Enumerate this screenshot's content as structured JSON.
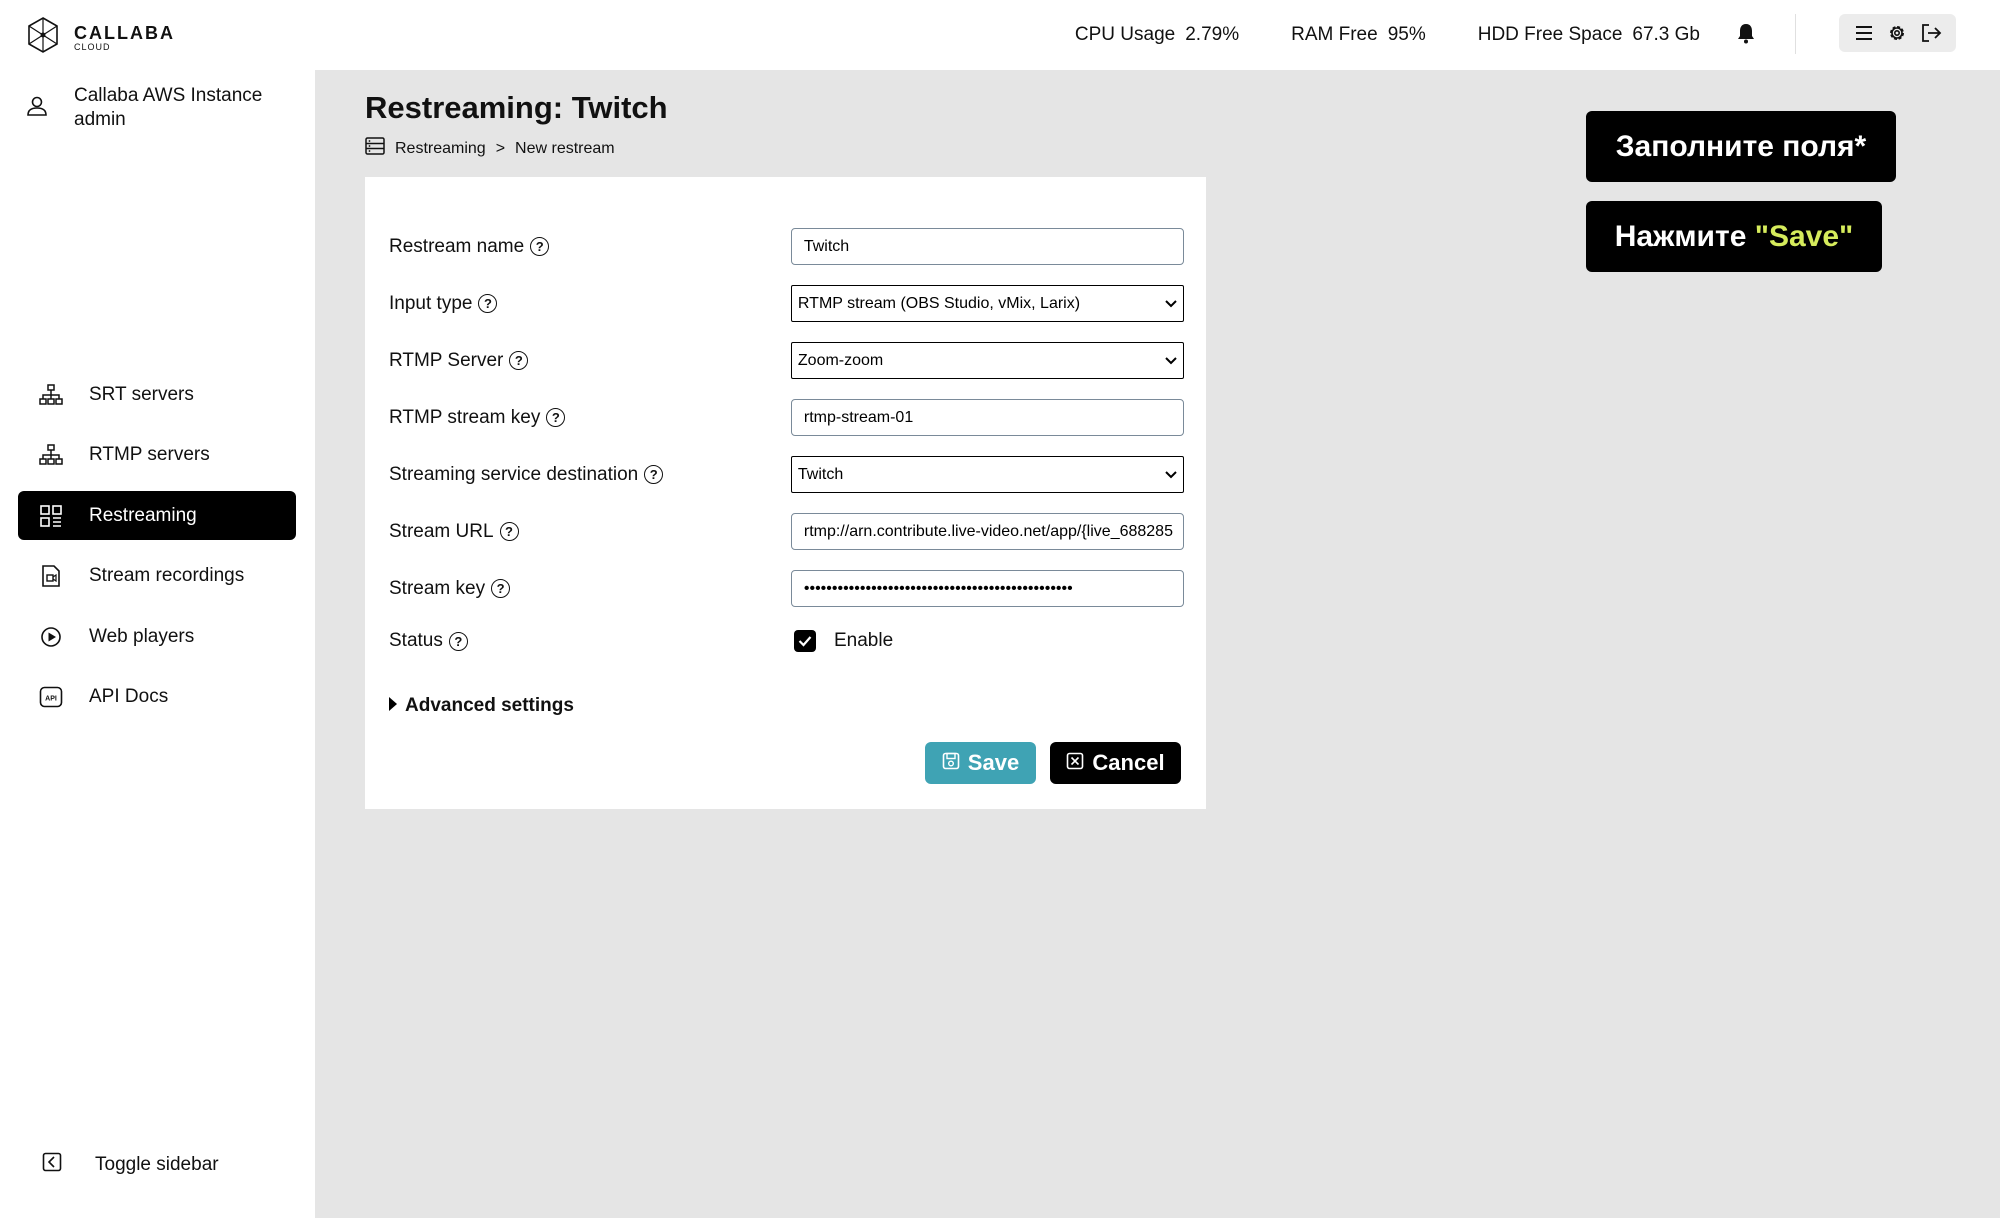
{
  "brand": {
    "name": "CALLABA",
    "sub": "CLOUD"
  },
  "user": {
    "instance": "Callaba AWS Instance",
    "role": "admin"
  },
  "nav": [
    {
      "label": "SRT servers",
      "icon": "network-icon",
      "active": false
    },
    {
      "label": "RTMP servers",
      "icon": "network-icon",
      "active": false
    },
    {
      "label": "Restreaming",
      "icon": "restream-icon",
      "active": true
    },
    {
      "label": "Stream recordings",
      "icon": "file-video-icon",
      "active": false
    },
    {
      "label": "Web players",
      "icon": "play-circle-icon",
      "active": false
    },
    {
      "label": "API Docs",
      "icon": "api-icon",
      "active": false
    }
  ],
  "toggle_sidebar": "Toggle sidebar",
  "stats": {
    "cpu_label": "CPU Usage",
    "cpu_value": "2.79%",
    "ram_label": "RAM Free",
    "ram_value": "95%",
    "hdd_label": "HDD Free Space",
    "hdd_value": "67.3 Gb"
  },
  "page": {
    "title": "Restreaming: Twitch",
    "breadcrumb": [
      "Restreaming",
      ">",
      "New restream"
    ]
  },
  "form": {
    "restream_name_label": "Restream name",
    "restream_name_value": "Twitch",
    "input_type_label": "Input type",
    "input_type_value": "RTMP stream (OBS Studio, vMix, Larix)",
    "rtmp_server_label": "RTMP Server",
    "rtmp_server_value": "Zoom-zoom",
    "rtmp_key_label": "RTMP stream key",
    "rtmp_key_value": "rtmp-stream-01",
    "destination_label": "Streaming service destination",
    "destination_value": "Twitch",
    "url_label": "Stream URL",
    "url_value": "rtmp://arn.contribute.live-video.net/app/{live_688285",
    "key_label": "Stream key",
    "key_value": "••••••••••••••••••••••••••••••••••••••••••••••••",
    "status_label": "Status",
    "status_checked": true,
    "enable_label": "Enable",
    "advanced_label": "Advanced settings",
    "save_label": "Save",
    "cancel_label": "Cancel",
    "save_color": "#3fa3b4"
  },
  "callouts": {
    "fill": "Заполните поля*",
    "press_prefix": "Нажмите ",
    "press_highlight": "\"Save\"",
    "highlight_color": "#d6ec5c"
  }
}
